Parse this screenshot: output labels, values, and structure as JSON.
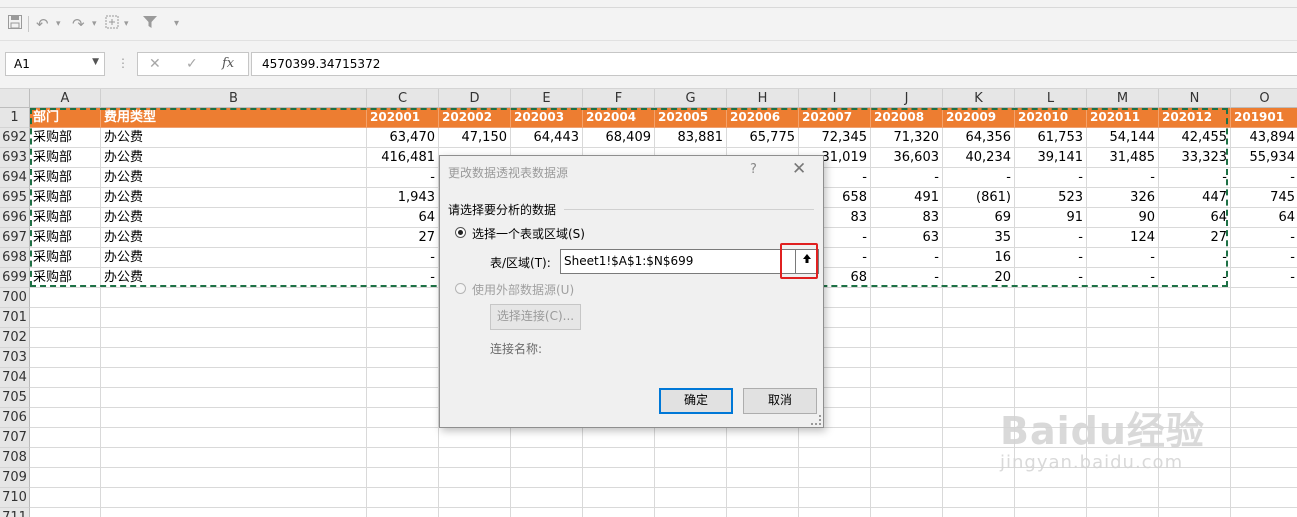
{
  "toolbar": {
    "icons": [
      "save-icon",
      "undo-icon",
      "redo-icon",
      "format-painter-icon",
      "filter-icon",
      "more-icon"
    ]
  },
  "formula_bar": {
    "name_box": "A1",
    "cancel_glyph": "✕",
    "enter_glyph": "✓",
    "fx_glyph": "fx",
    "value": "4570399.34715372"
  },
  "grid": {
    "columns": [
      "A",
      "B",
      "C",
      "D",
      "E",
      "F",
      "G",
      "H",
      "I",
      "J",
      "K",
      "L",
      "M",
      "N",
      "O"
    ],
    "header_row": {
      "row_number": "1",
      "cells": [
        "部门",
        "费用类型",
        "202001",
        "202002",
        "202003",
        "202004",
        "202005",
        "202006",
        "202007",
        "202008",
        "202009",
        "202010",
        "202011",
        "202012",
        "201901"
      ]
    },
    "rows": [
      {
        "row_number": "692",
        "cells": [
          "采购部",
          "办公费",
          "63,470",
          "47,150",
          "64,443",
          "68,409",
          "83,881",
          "65,775",
          "72,345",
          "71,320",
          "64,356",
          "61,753",
          "54,144",
          "42,455",
          "43,894"
        ]
      },
      {
        "row_number": "693",
        "cells": [
          "采购部",
          "办公费",
          "416,481",
          "",
          "",
          "",
          "",
          "",
          "31,019",
          "36,603",
          "40,234",
          "39,141",
          "31,485",
          "33,323",
          "55,934"
        ]
      },
      {
        "row_number": "694",
        "cells": [
          "采购部",
          "办公费",
          "-",
          "",
          "",
          "",
          "",
          "",
          "-",
          "-",
          "-",
          "-",
          "-",
          "-",
          "-"
        ]
      },
      {
        "row_number": "695",
        "cells": [
          "采购部",
          "办公费",
          "1,943",
          "",
          "",
          "",
          "",
          "",
          "658",
          "491",
          "(861)",
          "523",
          "326",
          "447",
          "745"
        ]
      },
      {
        "row_number": "696",
        "cells": [
          "采购部",
          "办公费",
          "64",
          "",
          "",
          "",
          "",
          "",
          "83",
          "83",
          "69",
          "91",
          "90",
          "64",
          "64"
        ]
      },
      {
        "row_number": "697",
        "cells": [
          "采购部",
          "办公费",
          "27",
          "",
          "",
          "",
          "",
          "",
          "-",
          "63",
          "35",
          "-",
          "124",
          "27",
          "-"
        ]
      },
      {
        "row_number": "698",
        "cells": [
          "采购部",
          "办公费",
          "-",
          "",
          "",
          "",
          "",
          "",
          "-",
          "-",
          "16",
          "-",
          "-",
          "-",
          "-"
        ]
      },
      {
        "row_number": "699",
        "cells": [
          "采购部",
          "办公费",
          "-",
          "",
          "",
          "",
          "",
          "",
          "68",
          "-",
          "20",
          "-",
          "-",
          "-",
          "-"
        ]
      }
    ],
    "empty_rows": [
      "700",
      "701",
      "702",
      "703",
      "704",
      "705",
      "706",
      "707",
      "708",
      "709",
      "710",
      "711"
    ]
  },
  "dialog": {
    "title": "更改数据透视表数据源",
    "help": "?",
    "close": "✕",
    "section_label": "请选择要分析的数据",
    "option_table_label": "选择一个表或区域(S)",
    "range_label": "表/区域(T):",
    "range_value": "Sheet1!$A$1:$N$699",
    "collapse_glyph": "🠹",
    "option_external_label": "使用外部数据源(U)",
    "choose_connection_label": "选择连接(C)...",
    "connection_name_label": "连接名称:",
    "ok_label": "确定",
    "cancel_label": "取消"
  },
  "watermark": {
    "brand": "Baidu经验",
    "url": "jingyan.baidu.com"
  }
}
